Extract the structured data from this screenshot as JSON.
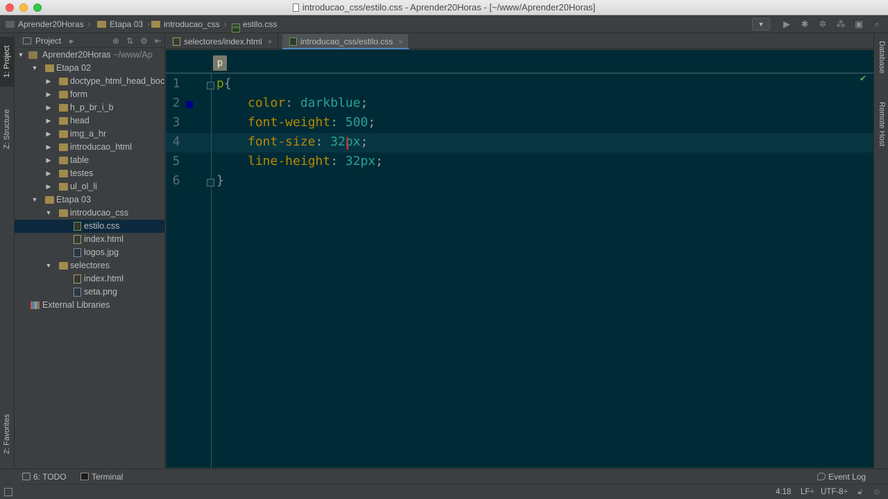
{
  "window": {
    "title": "introducao_css/estilo.css - Aprender20Horas - [~/www/Aprender20Horas]"
  },
  "navbar": {
    "crumbs": [
      "Aprender20Horas",
      "Etapa 03",
      "introducao_css",
      "estilo.css"
    ]
  },
  "left_strip": {
    "project_tab": "1: Project",
    "structure_tab": "Z: Structure",
    "favorites_tab": "2: Favorites"
  },
  "project_panel": {
    "title": "Project",
    "tree": {
      "root_name": "Aprender20Horas",
      "root_path": "~/www/Ap",
      "etapa02": "Etapa 02",
      "etapa02_children": [
        "doctype_html_head_boc",
        "form",
        "h_p_br_i_b",
        "head",
        "img_a_hr",
        "introducao_html",
        "table",
        "testes",
        "ul_ol_li"
      ],
      "etapa03": "Etapa 03",
      "introducao_css": "introducao_css",
      "introducao_css_files": [
        "estilo.css",
        "index.html",
        "logos.jpg"
      ],
      "selectores": "selectores",
      "selectores_files": [
        "index.html",
        "seta.png"
      ],
      "external_libraries": "External Libraries"
    }
  },
  "tabs": [
    {
      "label": "selectores/index.html",
      "close": "×"
    },
    {
      "label": "introducao_css/estilo.css",
      "close": "×"
    }
  ],
  "editor": {
    "breadcrumb_tag": "p",
    "line_numbers": [
      "1",
      "2",
      "3",
      "4",
      "5",
      "6"
    ],
    "code": {
      "selector": "p",
      "open_brace": "{",
      "close_brace": "}",
      "rules": [
        {
          "prop": "color",
          "value": "darkblue"
        },
        {
          "prop": "font-weight",
          "value": "500"
        },
        {
          "prop": "font-size",
          "value": "32px"
        },
        {
          "prop": "line-height",
          "value": "32px"
        }
      ]
    },
    "swatch_color": "#00008b"
  },
  "right_strip": {
    "database_tab": "Database",
    "remote_host_tab": "Remote Host"
  },
  "bottom_bar": {
    "todo": "6: TODO",
    "terminal": "Terminal",
    "event_log": "Event Log"
  },
  "status_bar": {
    "position": "4:18",
    "line_separator": "LF÷",
    "encoding": "UTF-8÷"
  }
}
